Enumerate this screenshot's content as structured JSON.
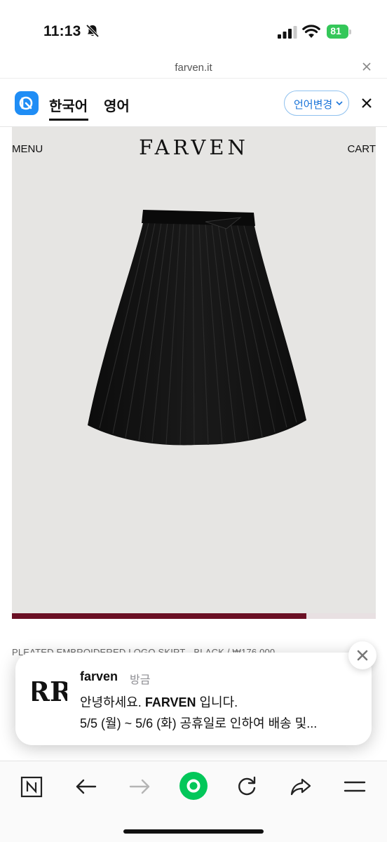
{
  "status_bar": {
    "time": "11:13",
    "battery": "81",
    "battery_color": "#34c759",
    "icons": [
      "bell-slash-icon",
      "signal-icon",
      "wifi-icon",
      "battery-icon"
    ]
  },
  "url_bar": {
    "url": "farven.it",
    "close_icon": "close-icon"
  },
  "translate_bar": {
    "languages": [
      "한국어",
      "영어"
    ],
    "selected_language": "한국어",
    "change_label": "언어변경",
    "accent_color": "#1a74d9",
    "icons": [
      "translate-app-icon",
      "chevron-down-icon",
      "close-icon"
    ]
  },
  "site": {
    "menu_label": "MENU",
    "brand": "FARVEN",
    "cart_label": "CART",
    "product_name": "PLEATED EMBROIDERED LOGO SKIRT - BLACK / ₩176,000",
    "image_progress": 0.81,
    "progress_color": "#6a0f24"
  },
  "notification": {
    "app": "farven",
    "time": "방금",
    "line1_prefix": "안녕하세요. ",
    "line1_bold": "FARVEN",
    "line1_suffix": " 입니다.",
    "line2": "5/5 (월) ~ 5/6 (화) 공휴일로 인하여 배송 및...",
    "close_icon": "close-icon"
  },
  "toolbar": {
    "items": [
      "naver-n-icon",
      "back-arrow-icon",
      "forward-arrow-icon",
      "green-home-icon",
      "refresh-icon",
      "share-icon",
      "menu-icon"
    ],
    "active_color": "#03c75a"
  }
}
